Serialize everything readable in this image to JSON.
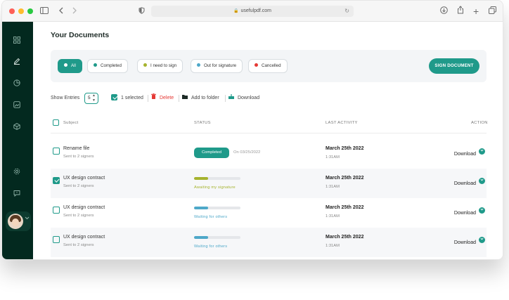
{
  "browser": {
    "url": "usefulpdf.com",
    "icons": [
      "sidebar-toggle-icon",
      "back-icon",
      "forward-icon",
      "privacy-shield-icon",
      "lock-icon",
      "reload-icon",
      "download-icon",
      "share-icon",
      "new-tab-icon",
      "tabs-overview-icon"
    ]
  },
  "sidebar": {
    "icons": [
      "grid-icon",
      "pen-icon",
      "pie-chart-icon",
      "image-icon",
      "cube-icon",
      "settings-icon",
      "chat-icon"
    ],
    "avatar_icon": "user-avatar",
    "chevron_icon": "chevron-down-icon"
  },
  "page": {
    "title": "Your Documents"
  },
  "filters": {
    "items": [
      {
        "label": "All",
        "dot_color": "#ffffff"
      },
      {
        "label": "Completed",
        "dot_color": "#1f9a8a"
      },
      {
        "label": "I need to sign",
        "dot_color": "#a6b32e"
      },
      {
        "label": "Out for signature",
        "dot_color": "#4ea8c9"
      },
      {
        "label": "Cancelled",
        "dot_color": "#e53935"
      }
    ],
    "sign_button": "SIGN DOCUMENT"
  },
  "toolbar": {
    "show_entries_label": "Show Entries",
    "entries_value": "5",
    "selected_label": "1 selected",
    "delete_label": "Delete",
    "add_folder_label": "Add to folder",
    "download_label": "Download",
    "delete_color": "#e53935"
  },
  "table": {
    "headers": {
      "subject": "Subject",
      "status": "STATUS",
      "last_activity": "LAST ACTIVITY",
      "action": "ACTION"
    },
    "rows": [
      {
        "title": "Rename file",
        "sub": "Sent to 2 signers",
        "checked": false,
        "status_type": "badge",
        "status_text": "Completed",
        "status_date": "On 03/25/2022",
        "progress": 0,
        "status_color": "#1f9a8a",
        "date": "March 25th 2022",
        "time": "1:31AM",
        "action": "Download"
      },
      {
        "title": "UX design contract",
        "sub": "Sent to 2 signers",
        "checked": true,
        "status_type": "progress",
        "status_text": "Awaiting my signature",
        "progress": 0.3,
        "status_color": "#a6b32e",
        "date": "March 25th 2022",
        "time": "1:31AM",
        "action": "Download"
      },
      {
        "title": "UX design contract",
        "sub": "Sent to 2 signers",
        "checked": false,
        "status_type": "progress",
        "status_text": "Waiting for others",
        "progress": 0.3,
        "status_color": "#4ea8c9",
        "date": "March 25th 2022",
        "time": "1:31AM",
        "action": "Download"
      },
      {
        "title": "UX design contract",
        "sub": "Sent to 2 signers",
        "checked": false,
        "status_type": "progress",
        "status_text": "Waiting for others",
        "progress": 0.3,
        "status_color": "#4ea8c9",
        "date": "March 25th 2022",
        "time": "1:31AM",
        "action": "Download"
      }
    ]
  }
}
